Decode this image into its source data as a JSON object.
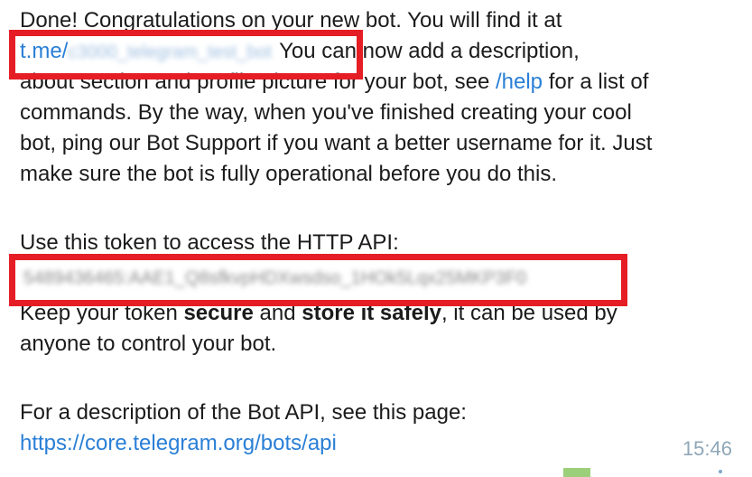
{
  "message": {
    "line1": "Done! Congratulations on your new bot. You will find it at",
    "bot_link_prefix": "t.me/",
    "bot_link_username": "c3000_telegram_test_bot",
    "line2_rest": "You can now add a description,",
    "line3_start": "about section and profile picture for your bot, see ",
    "help_link": "/help",
    "line3_end": " for a list of",
    "line4": "commands. By the way, when you've finished creating your cool",
    "line5": "bot, ping our Bot Support if you want a better username for it. Just",
    "line6": "make sure the bot is fully operational before you do this.",
    "token_label": "Use this token to access the HTTP API:",
    "token_value": "5489436465:AAE1_Q8sfkvpHDXwsdso_1HOk5Lqx25MKP3F0",
    "keep_1": "Keep your token ",
    "keep_bold1": "secure",
    "keep_2": " and ",
    "keep_bold2": "store it safely",
    "keep_3": ", it can be used by",
    "keep_line2": "anyone to control your bot.",
    "api_desc": "For a description of the Bot API, see this page:",
    "api_link": "https://core.telegram.org/bots/api",
    "timestamp": "15:46"
  },
  "colors": {
    "link": "#2a7fd6",
    "highlight_box": "#e51e25",
    "timestamp": "#8fa7b8"
  }
}
